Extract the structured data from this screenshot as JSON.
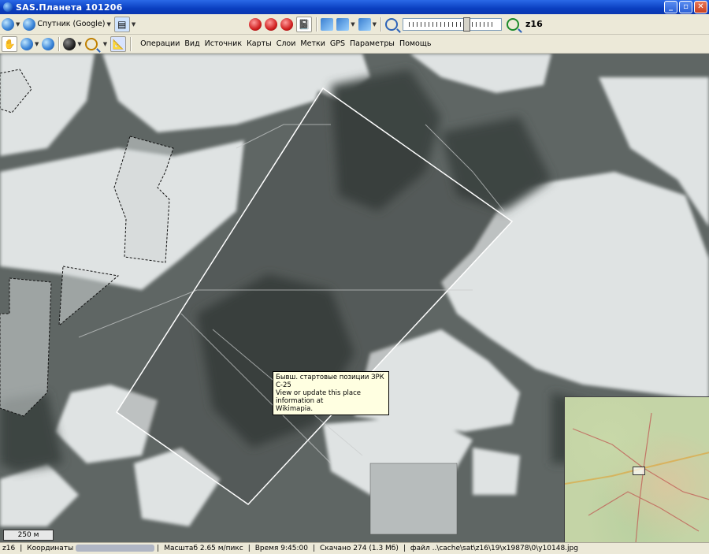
{
  "window": {
    "title": "SAS.Планета 101206"
  },
  "toolbar": {
    "map_source_label": "Спутник (Google)",
    "zoom_level": "z16",
    "zoom_slider_fraction": 0.66,
    "menu": [
      "Операции",
      "Вид",
      "Источник",
      "Карты",
      "Слои",
      "Метки",
      "GPS",
      "Параметры",
      "Помощь"
    ]
  },
  "map": {
    "scale_label": "250 м",
    "tooltip": {
      "line1": "Бывш. стартовые позиции ЗРК С-25",
      "line2": "View or update this place information at",
      "line3": "Wikimapia."
    }
  },
  "statusbar": {
    "zoom": "z16",
    "coords_label": "Координаты",
    "scale": "Масштаб 2.65 м/пикс",
    "time": "Время 9:45:00",
    "downloaded": "Скачано 274 (1.3 Мб)",
    "file": "файл ..\\cache\\sat\\z16\\19\\x19878\\0\\y10148.jpg"
  }
}
